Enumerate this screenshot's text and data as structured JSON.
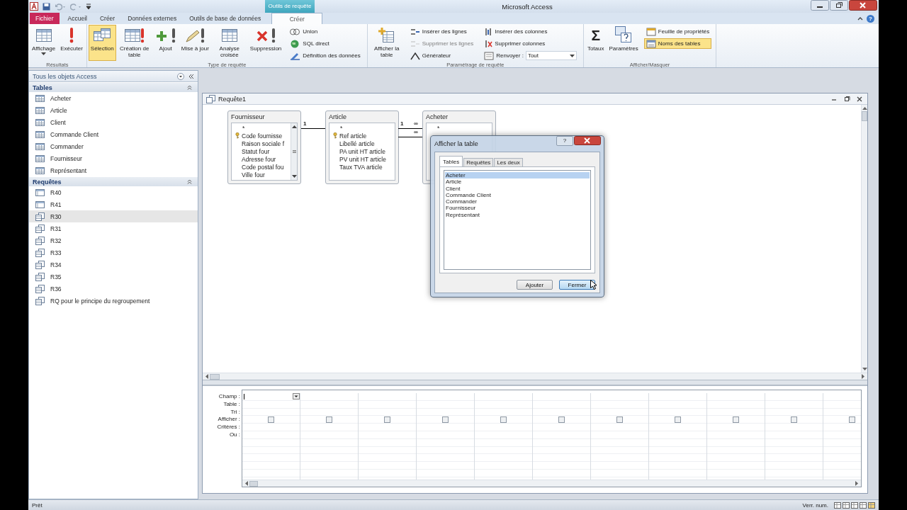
{
  "title_bar": {
    "title": "Microsoft Access",
    "context_tab": "Outils de requête"
  },
  "ribbon_tabs": [
    {
      "label": "Fichier",
      "kind": "file",
      "selected": false
    },
    {
      "label": "Accueil",
      "kind": "tab",
      "selected": false
    },
    {
      "label": "Créer",
      "kind": "tab",
      "selected": false
    },
    {
      "label": "Données externes",
      "kind": "tab",
      "selected": false
    },
    {
      "label": "Outils de base de données",
      "kind": "tab",
      "selected": false
    },
    {
      "label": "Créer",
      "kind": "context",
      "selected": true
    }
  ],
  "ribbon_help": "?",
  "ribbon_groups": [
    {
      "label": "Résultats",
      "buttons": [
        {
          "label": "Affichage",
          "kind": "large",
          "dropdown": true,
          "selected": false,
          "disabled": false
        },
        {
          "label": "Exécuter",
          "kind": "large",
          "selected": false,
          "disabled": false
        }
      ]
    },
    {
      "label": "Type de requête",
      "buttons": [
        {
          "label": "Sélection",
          "kind": "large",
          "selected": true,
          "disabled": false
        },
        {
          "label": "Création de table",
          "kind": "large",
          "selected": false,
          "disabled": false
        },
        {
          "label": "Ajout",
          "kind": "large",
          "selected": false,
          "disabled": false
        },
        {
          "label": "Mise à jour",
          "kind": "large",
          "selected": false,
          "disabled": false
        },
        {
          "label": "Analyse croisée",
          "kind": "large",
          "selected": false,
          "disabled": false
        },
        {
          "label": "Suppression",
          "kind": "large",
          "selected": false,
          "disabled": false
        },
        {
          "label": "Union",
          "kind": "small",
          "selected": false,
          "disabled": false
        },
        {
          "label": "SQL direct",
          "kind": "small",
          "selected": false,
          "disabled": false
        },
        {
          "label": "Définition des données",
          "kind": "small",
          "selected": false,
          "disabled": false
        }
      ]
    },
    {
      "label": "Paramétrage de requête",
      "buttons": [
        {
          "label": "Afficher la table",
          "kind": "large",
          "selected": false,
          "disabled": false
        },
        {
          "label": "Insérer des lignes",
          "kind": "small",
          "selected": false,
          "disabled": false
        },
        {
          "label": "Supprimer les lignes",
          "kind": "small",
          "selected": false,
          "disabled": true
        },
        {
          "label": "Générateur",
          "kind": "small",
          "selected": false,
          "disabled": false
        },
        {
          "label": "Insérer des colonnes",
          "kind": "small",
          "selected": false,
          "disabled": false
        },
        {
          "label": "Supprimer colonnes",
          "kind": "small",
          "selected": false,
          "disabled": false
        },
        {
          "label": "Renvoyer :",
          "value": "Tout",
          "kind": "combo",
          "dropdown": true,
          "selected": false,
          "disabled": false
        }
      ]
    },
    {
      "label": "Afficher/Masquer",
      "buttons": [
        {
          "label": "Totaux",
          "glyph": "Σ",
          "kind": "large",
          "selected": false,
          "disabled": false
        },
        {
          "label": "Paramètres",
          "kind": "large",
          "selected": false,
          "disabled": false
        },
        {
          "label": "Feuille de propriétés",
          "kind": "small",
          "selected": false,
          "disabled": false
        },
        {
          "label": "Noms des tables",
          "kind": "small",
          "selected": true,
          "disabled": false
        }
      ]
    }
  ],
  "navigation_pane": {
    "title": "Tous les objets Access",
    "sections": [
      {
        "title": "Tables",
        "items": [
          {
            "label": "Acheter",
            "kind": "table",
            "selected": false
          },
          {
            "label": "Article",
            "kind": "table",
            "selected": false
          },
          {
            "label": "Client",
            "kind": "table",
            "selected": false
          },
          {
            "label": "Commande Client",
            "kind": "table",
            "selected": false
          },
          {
            "label": "Commander",
            "kind": "table",
            "selected": false
          },
          {
            "label": "Fournisseur",
            "kind": "table",
            "selected": false
          },
          {
            "label": "Représentant",
            "kind": "table",
            "selected": false
          }
        ]
      },
      {
        "title": "Requêtes",
        "items": [
          {
            "label": "R40",
            "kind": "maketable",
            "selected": false
          },
          {
            "label": "R41",
            "kind": "maketable",
            "selected": false
          },
          {
            "label": "R30",
            "kind": "select",
            "selected": true
          },
          {
            "label": "R31",
            "kind": "select",
            "selected": false
          },
          {
            "label": "R32",
            "kind": "select",
            "selected": false
          },
          {
            "label": "R33",
            "kind": "select",
            "selected": false
          },
          {
            "label": "R34",
            "kind": "select",
            "selected": false
          },
          {
            "label": "R35",
            "kind": "select",
            "selected": false
          },
          {
            "label": "R36",
            "kind": "select",
            "selected": false
          },
          {
            "label": "RQ pour le principe du regroupement",
            "kind": "select",
            "selected": false
          }
        ]
      }
    ]
  },
  "query_window": {
    "title": "Requête1",
    "tables": [
      {
        "name": "Fournisseur",
        "scrollbar": true,
        "fields": [
          {
            "label": "*",
            "key": false
          },
          {
            "label": "Code fournisse",
            "key": true
          },
          {
            "label": "Raison sociale f",
            "key": false
          },
          {
            "label": "Statut four",
            "key": false
          },
          {
            "label": "Adresse four",
            "key": false
          },
          {
            "label": "Code postal fou",
            "key": false
          },
          {
            "label": "Ville four",
            "key": false
          }
        ]
      },
      {
        "name": "Article",
        "scrollbar": false,
        "fields": [
          {
            "label": "*",
            "key": false
          },
          {
            "label": "Ref article",
            "key": true
          },
          {
            "label": "Libellé article",
            "key": false
          },
          {
            "label": "PA unit HT article",
            "key": false
          },
          {
            "label": "PV unit HT article",
            "key": false
          },
          {
            "label": "Taux TVA article",
            "key": false
          }
        ]
      },
      {
        "name": "Acheter",
        "scrollbar": false,
        "fields": [
          {
            "label": "*",
            "key": false
          }
        ]
      }
    ],
    "joins": [
      {
        "marks": [
          "1"
        ]
      },
      {
        "marks": [
          "1",
          "∞"
        ]
      },
      {
        "marks": [
          "∞"
        ]
      }
    ],
    "grid": {
      "row_labels": [
        "Champ :",
        "Table :",
        "Tri :",
        "Afficher :",
        "Critères :",
        "Ou :"
      ],
      "columns": [
        {
          "show": false,
          "focused": true
        },
        {
          "show": false
        },
        {
          "show": false
        },
        {
          "show": false
        },
        {
          "show": false
        },
        {
          "show": false
        },
        {
          "show": false
        },
        {
          "show": false
        },
        {
          "show": false
        },
        {
          "show": false
        },
        {
          "show": false
        }
      ]
    }
  },
  "dialog": {
    "title": "Afficher la table",
    "help": "?",
    "tabs": [
      {
        "label": "Tables",
        "selected": true
      },
      {
        "label": "Requêtes",
        "selected": false
      },
      {
        "label": "Les deux",
        "selected": false
      }
    ],
    "items": [
      {
        "label": "Acheter",
        "selected": true
      },
      {
        "label": "Article",
        "selected": false
      },
      {
        "label": "Client",
        "selected": false
      },
      {
        "label": "Commande Client",
        "selected": false
      },
      {
        "label": "Commander",
        "selected": false
      },
      {
        "label": "Fournisseur",
        "selected": false
      },
      {
        "label": "Représentant",
        "selected": false
      }
    ],
    "buttons": [
      {
        "label": "Ajouter",
        "default": false
      },
      {
        "label": "Fermer",
        "default": true
      }
    ]
  },
  "status_bar": {
    "left": "Prêt",
    "right": "Verr. num."
  }
}
